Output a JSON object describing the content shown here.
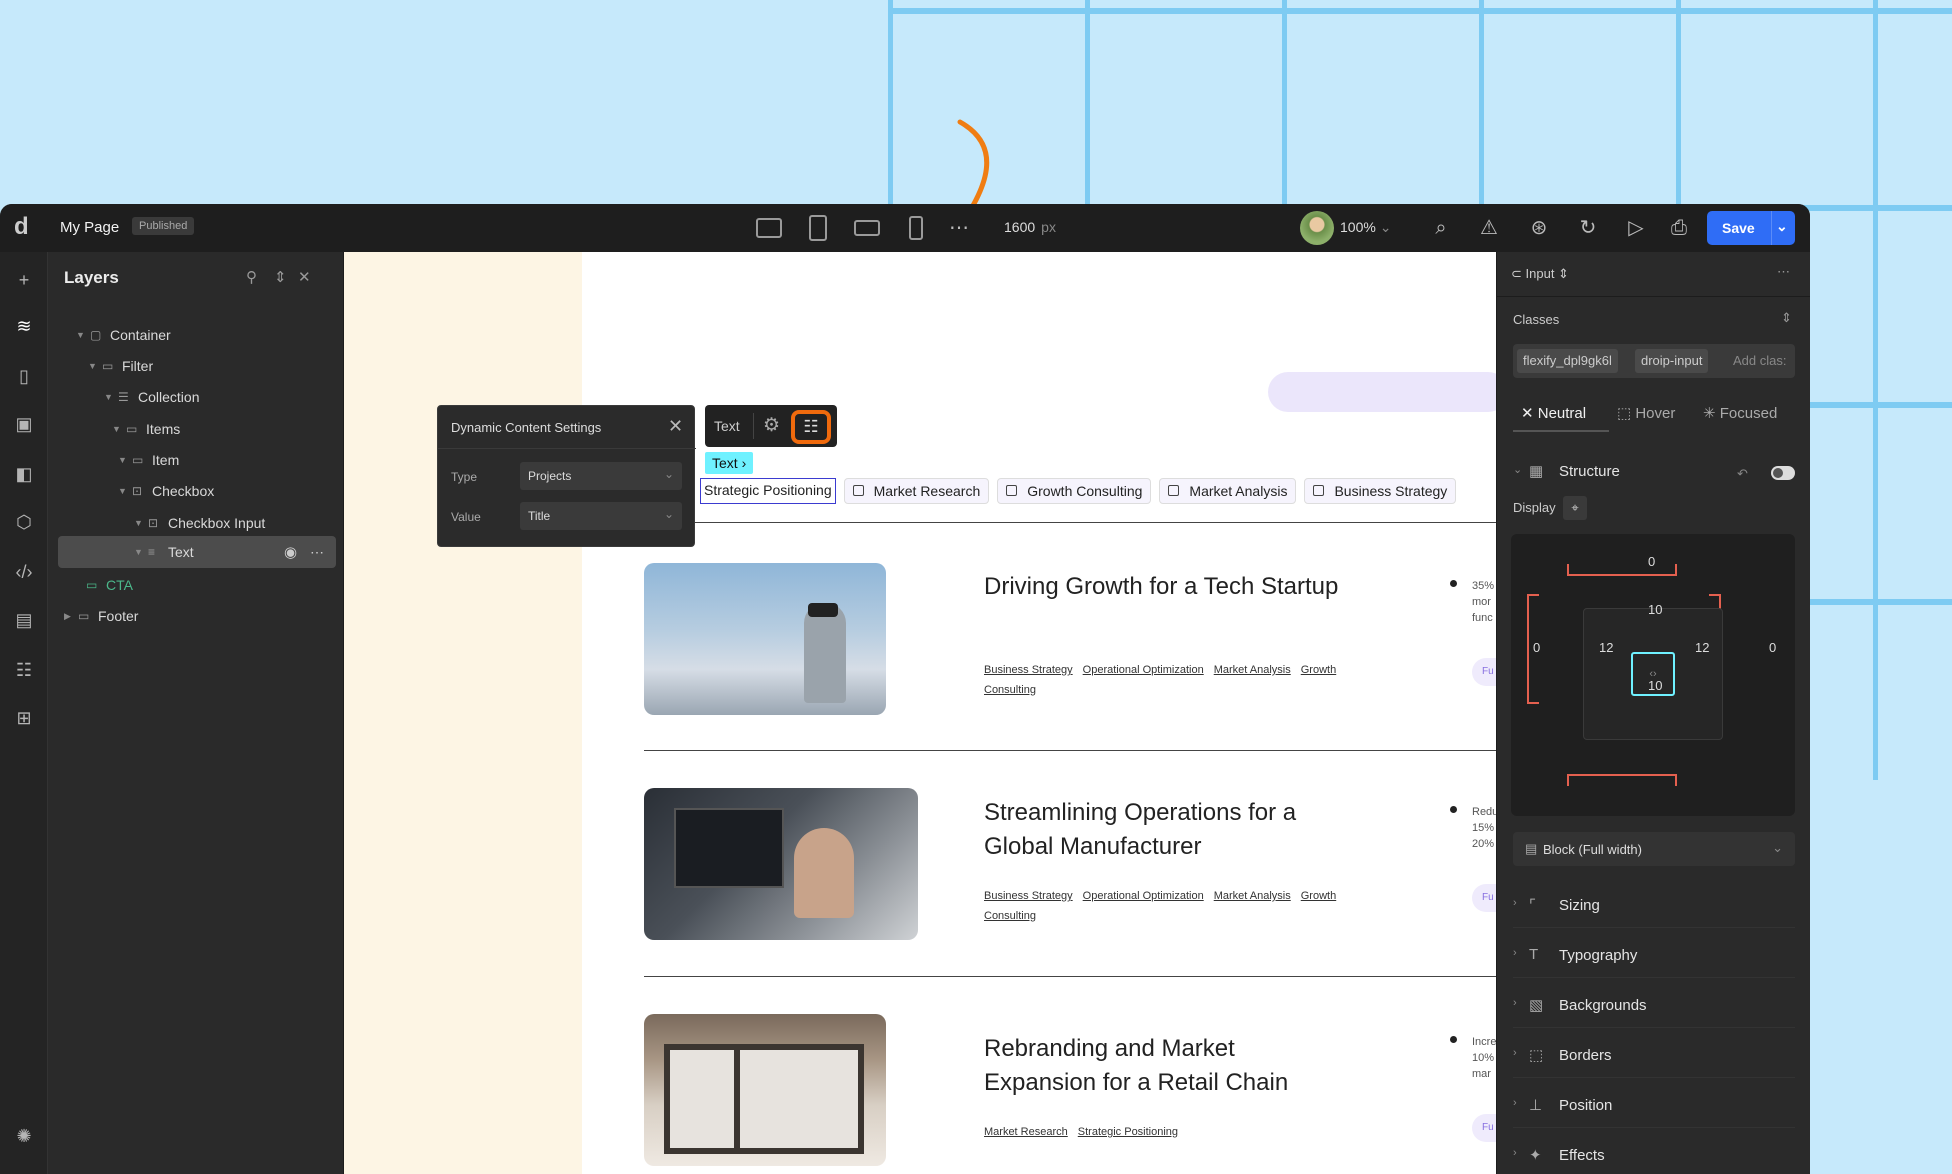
{
  "topbar": {
    "logo": "d",
    "page_title": "My Page",
    "status_badge": "Published",
    "width_value": "1600",
    "width_unit": "px",
    "zoom": "100%",
    "save_label": "Save"
  },
  "layers": {
    "title": "Layers",
    "rows": [
      {
        "label": "Container"
      },
      {
        "label": "Filter"
      },
      {
        "label": "Collection"
      },
      {
        "label": "Items"
      },
      {
        "label": "Item"
      },
      {
        "label": "Checkbox"
      },
      {
        "label": "Checkbox Input"
      },
      {
        "label": "Text"
      },
      {
        "label": "CTA"
      },
      {
        "label": "Footer"
      }
    ]
  },
  "dynamic_settings": {
    "title": "Dynamic Content Settings",
    "type_label": "Type",
    "type_value": "Projects",
    "value_label": "Value",
    "value_value": "Title"
  },
  "mini_toolbar": {
    "text_label": "Text",
    "breadcrumb": "Text"
  },
  "canvas": {
    "tags": [
      "Strategic Positioning",
      "Market Research",
      "Growth Consulting",
      "Market Analysis",
      "Business Strategy"
    ],
    "projects": [
      {
        "title": "Driving Growth for a Tech Startup",
        "links": [
          "Business Strategy",
          "Operational Optimization",
          "Market Analysis",
          "Growth Consulting"
        ],
        "side_text": [
          "35%",
          "mor",
          "func"
        ],
        "pill": "Fu"
      },
      {
        "title": "Streamlining Operations for a Global Manufacturer",
        "links": [
          "Business Strategy",
          "Operational Optimization",
          "Market Analysis",
          "Growth Consulting"
        ],
        "side_text": [
          "Redu",
          "15%",
          "20%"
        ],
        "pill": "Fu"
      },
      {
        "title": "Rebranding and Market Expansion for a Retail Chain",
        "links": [
          "Market Research",
          "Strategic Positioning"
        ],
        "side_text": [
          "Incre",
          "10%",
          "mar"
        ],
        "pill": "Fu"
      }
    ]
  },
  "style_panel": {
    "element": "Input",
    "classes_label": "Classes",
    "classes": [
      "flexify_dpl9gk6l",
      "droip-input"
    ],
    "add_class_placeholder": "Add clas:",
    "states": [
      "Neutral",
      "Hover",
      "Focused"
    ],
    "structure_label": "Structure",
    "display_label": "Display",
    "margin": {
      "top": "0",
      "right": "0",
      "bottom": "0",
      "left": "0"
    },
    "padding": {
      "top": "10",
      "right": "12",
      "bottom": "10",
      "left": "12"
    },
    "display_value": "Block (Full width)",
    "sections": [
      "Sizing",
      "Typography",
      "Backgrounds",
      "Borders",
      "Position",
      "Effects"
    ]
  },
  "colors": {
    "accent": "#2f6df6",
    "highlight": "#f06a0d",
    "cyan": "#6ff1ff",
    "cta": "#4bb78a"
  }
}
